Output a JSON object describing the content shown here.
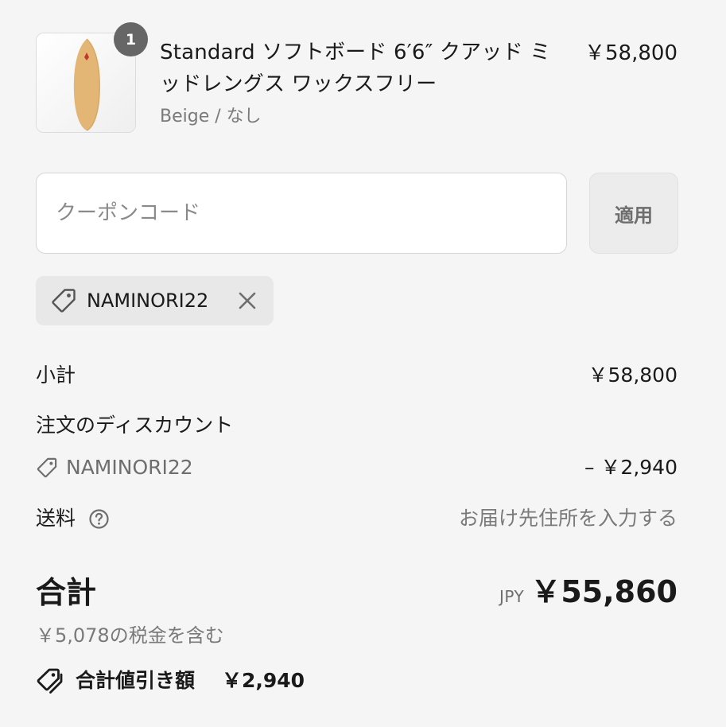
{
  "product": {
    "quantity": "1",
    "title": "Standard ソフトボード 6′6″ クアッド ミッドレングス ワックスフリー",
    "variant": "Beige / なし",
    "price": "￥58,800",
    "image_icon": "surfboard-image",
    "board_color": "#e3b676"
  },
  "coupon": {
    "placeholder": "クーポンコード",
    "value": "",
    "apply_label": "適用"
  },
  "applied_code": {
    "code": "NAMINORI22",
    "icon": "tag-icon",
    "remove_icon": "close-icon"
  },
  "summary": {
    "subtotal_label": "小計",
    "subtotal_value": "￥58,800",
    "discount_label": "注文のディスカウント",
    "discount_code": "NAMINORI22",
    "discount_value": "– ￥2,940",
    "shipping_label": "送料",
    "shipping_help_icon": "question-circle-icon",
    "shipping_value": "お届け先住所を入力する"
  },
  "total": {
    "label": "合計",
    "currency": "JPY",
    "value": "￥55,860",
    "tax_note": "￥5,078の税金を含む",
    "savings_label": "合計値引き額",
    "savings_amount": "￥2,940",
    "savings_icon": "tags-icon"
  },
  "colors": {
    "background": "#f5f5f5",
    "badge": "#666666",
    "muted_text": "#7a7a7a"
  }
}
